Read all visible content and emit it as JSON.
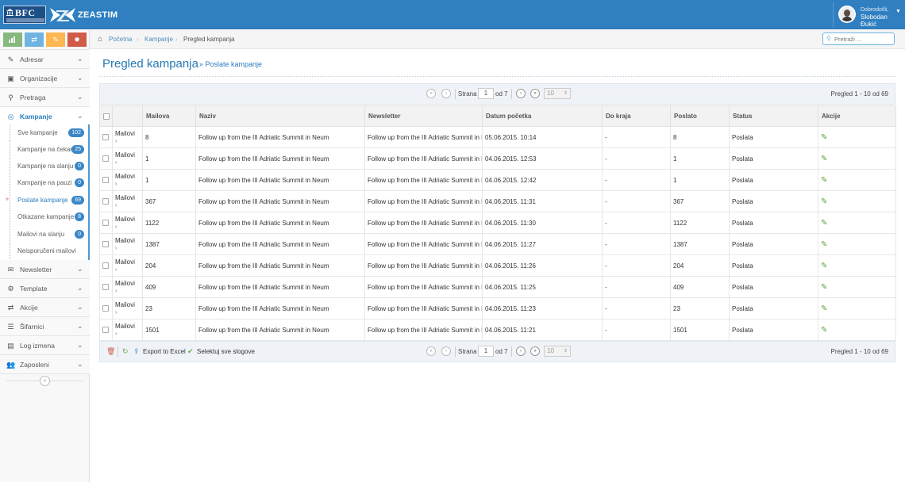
{
  "brand": {
    "bfc_logo_text": "BFC",
    "app_name": "ZEASTIM"
  },
  "user": {
    "greeting": "Dobrodošli,",
    "name": "Slobodan Đukić"
  },
  "shortcuts": [
    {
      "icon": "bar-chart-icon",
      "color": "#87b87f"
    },
    {
      "icon": "exchange-icon",
      "color": "#6fb3e0"
    },
    {
      "icon": "pencil-icon",
      "color": "#ffb752"
    },
    {
      "icon": "cogs-icon",
      "color": "#d15b47"
    }
  ],
  "sidebar": {
    "items": [
      {
        "label": "Adresar",
        "icon": "edit-icon"
      },
      {
        "label": "Organizacije",
        "icon": "briefcase-icon"
      },
      {
        "label": "Pretraga",
        "icon": "search-icon"
      },
      {
        "label": "Kampanje",
        "icon": "compass-icon"
      },
      {
        "label": "Newsletter",
        "icon": "envelope-icon"
      },
      {
        "label": "Template",
        "icon": "cogs-icon"
      },
      {
        "label": "Akcije",
        "icon": "exchange-icon"
      },
      {
        "label": "Šifarnici",
        "icon": "list-icon"
      },
      {
        "label": "Log izmena",
        "icon": "list-alt-icon"
      },
      {
        "label": "Zaposleni",
        "icon": "users-icon"
      }
    ],
    "submenu": [
      {
        "label": "Sve kampanje",
        "badge": "102"
      },
      {
        "label": "Kampanje na čekanju",
        "badge": "25"
      },
      {
        "label": "Kampanje na slanju",
        "badge": "0"
      },
      {
        "label": "Kampanje na pauzi",
        "badge": "0"
      },
      {
        "label": "Poslate kampanje",
        "badge": "69"
      },
      {
        "label": "Otkazane kampanje",
        "badge": "8"
      },
      {
        "label": "Mailovi na slanju",
        "badge": "0"
      },
      {
        "label": "Neisporučeni mailovi",
        "badge": ""
      }
    ]
  },
  "breadcrumb": {
    "home": "Početna",
    "section": "Kampanje",
    "current": "Pregled kampanja"
  },
  "search": {
    "placeholder": "Pretraži ..."
  },
  "page": {
    "title": "Pregled kampanja",
    "subtitle": "» Poslate kampanje"
  },
  "pager": {
    "page_label": "Strana",
    "page_value": "1",
    "of_label": "od 7",
    "rows_per_page": "10",
    "info": "Pregled 1 - 10 od 69"
  },
  "table": {
    "columns": [
      "",
      "",
      "Mailova",
      "Naziv",
      "Newsletter",
      "Datum početka",
      "Do kraja",
      "Poslato",
      "Status",
      "Akcije"
    ],
    "mailovi_label": "Mailovi",
    "rows": [
      {
        "mailova": "8",
        "naziv": "Follow up from the III Adriatic Summit in Neum",
        "newsletter": "Follow up from the III Adriatic Summit in Neum",
        "datum": "05.06.2015. 10:14",
        "do_kraja": "-",
        "poslato": "8",
        "status": "Poslata"
      },
      {
        "mailova": "1",
        "naziv": "Follow up from the III Adriatic Summit in Neum",
        "newsletter": "Follow up from the III Adriatic Summit in Neum",
        "datum": "04.06.2015. 12:53",
        "do_kraja": "-",
        "poslato": "1",
        "status": "Poslata"
      },
      {
        "mailova": "1",
        "naziv": "Follow up from the III Adriatic Summit in Neum",
        "newsletter": "Follow up from the III Adriatic Summit in Neum",
        "datum": "04.06.2015. 12:42",
        "do_kraja": "-",
        "poslato": "1",
        "status": "Poslata"
      },
      {
        "mailova": "367",
        "naziv": "Follow up from the III Adriatic Summit in Neum",
        "newsletter": "Follow up from the III Adriatic Summit in Neum",
        "datum": "04.06.2015. 11:31",
        "do_kraja": "-",
        "poslato": "367",
        "status": "Poslata"
      },
      {
        "mailova": "1122",
        "naziv": "Follow up from the III Adriatic Summit in Neum",
        "newsletter": "Follow up from the III Adriatic Summit in Neum",
        "datum": "04.06.2015. 11:30",
        "do_kraja": "-",
        "poslato": "1122",
        "status": "Poslata"
      },
      {
        "mailova": "1387",
        "naziv": "Follow up from the III Adriatic Summit in Neum",
        "newsletter": "Follow up from the III Adriatic Summit in Neum",
        "datum": "04.06.2015. 11:27",
        "do_kraja": "-",
        "poslato": "1387",
        "status": "Poslata"
      },
      {
        "mailova": "204",
        "naziv": "Follow up from the III Adriatic Summit in Neum",
        "newsletter": "Follow up from the III Adriatic Summit in Neum",
        "datum": "04.06.2015. 11:26",
        "do_kraja": "-",
        "poslato": "204",
        "status": "Poslata"
      },
      {
        "mailova": "409",
        "naziv": "Follow up from the III Adriatic Summit in Neum",
        "newsletter": "Follow up from the III Adriatic Summit in Neum",
        "datum": "04.06.2015. 11:25",
        "do_kraja": "-",
        "poslato": "409",
        "status": "Poslata"
      },
      {
        "mailova": "23",
        "naziv": "Follow up from the III Adriatic Summit in Neum",
        "newsletter": "Follow up from the III Adriatic Summit in Neum",
        "datum": "04.06.2015. 11:23",
        "do_kraja": "-",
        "poslato": "23",
        "status": "Poslata"
      },
      {
        "mailova": "1501",
        "naziv": "Follow up from the III Adriatic Summit in Neum",
        "newsletter": "Follow up from the III Adriatic Summit in Neum",
        "datum": "04.06.2015. 11:21",
        "do_kraja": "-",
        "poslato": "1501",
        "status": "Poslata"
      }
    ]
  },
  "footer_actions": {
    "export_label": "Export to Excel",
    "select_all_label": "Selektuj sve slogove"
  }
}
